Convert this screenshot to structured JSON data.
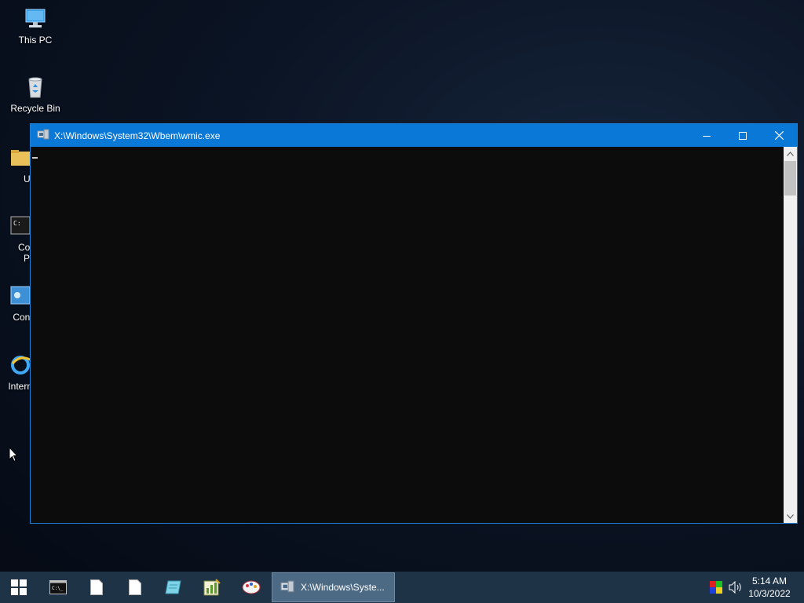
{
  "desktop": {
    "icons": [
      {
        "label": "This PC",
        "icon": "this-pc-icon"
      },
      {
        "label": "Recycle Bin",
        "icon": "recycle-bin-icon"
      },
      {
        "label": "Ut",
        "icon": "utilities-folder-icon"
      },
      {
        "label": "Con",
        "label2": "Pr",
        "icon": "command-prompt-icon"
      },
      {
        "label": "Contr",
        "icon": "control-panel-icon"
      },
      {
        "label": "Interne",
        "icon": "internet-explorer-icon"
      }
    ]
  },
  "window": {
    "title": "X:\\Windows\\System32\\Wbem\\wmic.exe",
    "console_text": "",
    "buttons": {
      "minimize": "minimize",
      "maximize": "maximize",
      "close": "close"
    }
  },
  "taskbar": {
    "pinned": [
      "start-icon",
      "cmd-icon",
      "file-icon",
      "file-icon",
      "notepad-icon",
      "chart-icon",
      "paint-icon"
    ],
    "active_task": "X:\\Windows\\Syste...",
    "tray": {
      "icons": [
        "color-icon",
        "volume-icon"
      ]
    },
    "clock": {
      "time": "5:14 AM",
      "date": "10/3/2022"
    }
  },
  "colors": {
    "titlebar": "#0a78d7",
    "taskbar": "#1f3346",
    "console_bg": "#0c0c0c"
  }
}
